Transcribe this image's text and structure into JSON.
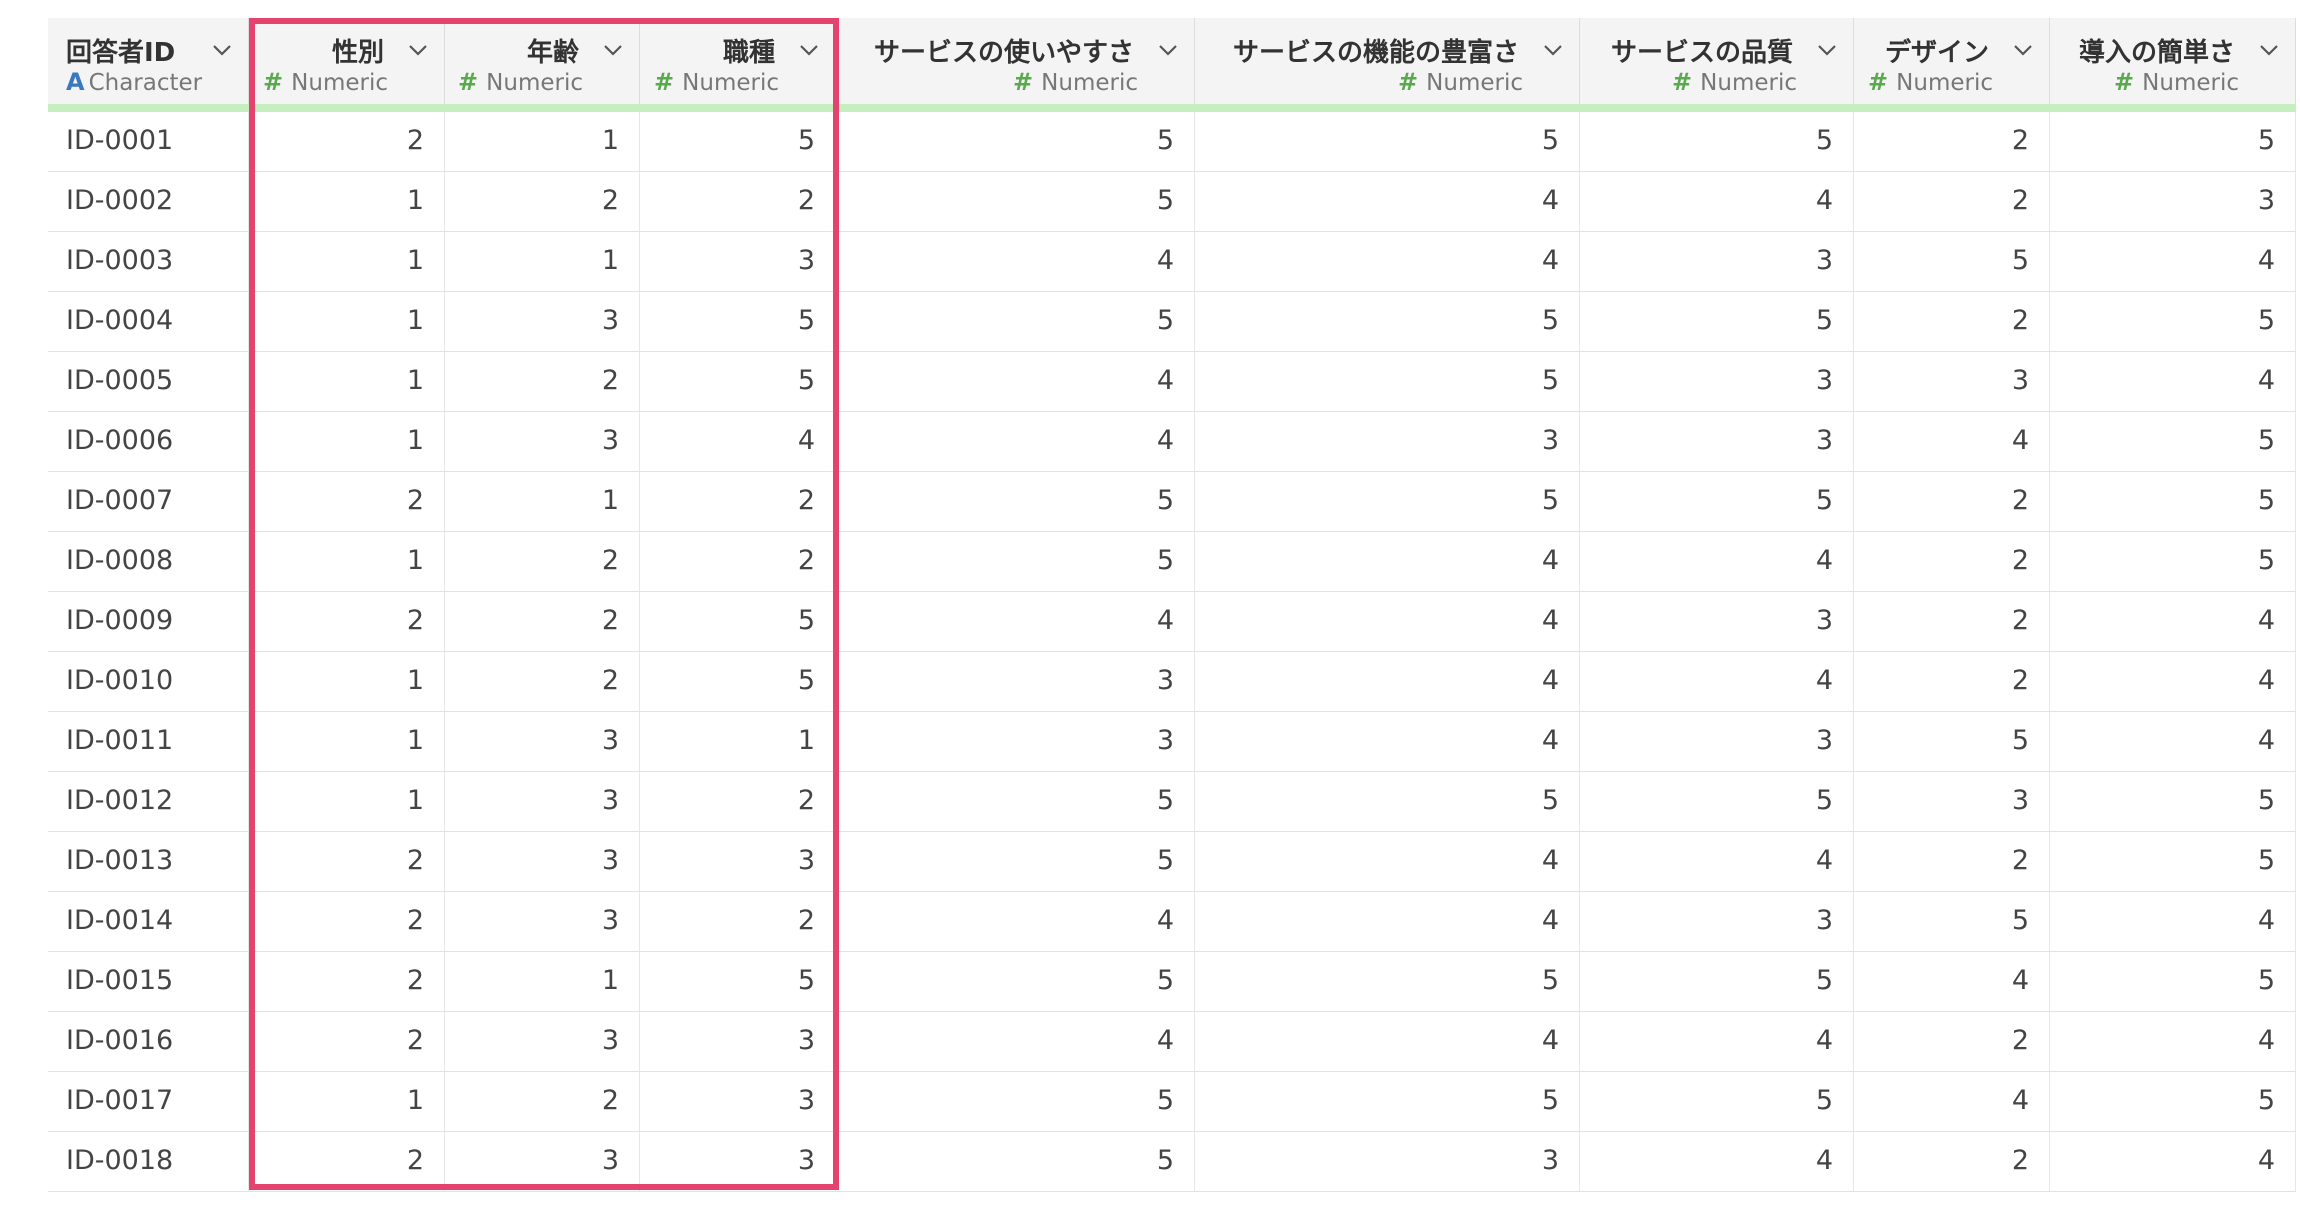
{
  "columns": [
    {
      "name": "回答者ID",
      "type": "Character",
      "type_icon": "character-type-icon"
    },
    {
      "name": "性別",
      "type": "Numeric",
      "type_icon": "numeric-type-icon"
    },
    {
      "name": "年齢",
      "type": "Numeric",
      "type_icon": "numeric-type-icon"
    },
    {
      "name": "職種",
      "type": "Numeric",
      "type_icon": "numeric-type-icon"
    },
    {
      "name": "サービスの使いやすさ",
      "type": "Numeric",
      "type_icon": "numeric-type-icon"
    },
    {
      "name": "サービスの機能の豊富さ",
      "type": "Numeric",
      "type_icon": "numeric-type-icon"
    },
    {
      "name": "サービスの品質",
      "type": "Numeric",
      "type_icon": "numeric-type-icon"
    },
    {
      "name": "デザイン",
      "type": "Numeric",
      "type_icon": "numeric-type-icon"
    },
    {
      "name": "導入の簡単さ",
      "type": "Numeric",
      "type_icon": "numeric-type-icon"
    }
  ],
  "rows": [
    [
      "ID-0001",
      "2",
      "1",
      "5",
      "5",
      "5",
      "5",
      "2",
      "5"
    ],
    [
      "ID-0002",
      "1",
      "2",
      "2",
      "5",
      "4",
      "4",
      "2",
      "3"
    ],
    [
      "ID-0003",
      "1",
      "1",
      "3",
      "4",
      "4",
      "3",
      "5",
      "4"
    ],
    [
      "ID-0004",
      "1",
      "3",
      "5",
      "5",
      "5",
      "5",
      "2",
      "5"
    ],
    [
      "ID-0005",
      "1",
      "2",
      "5",
      "4",
      "5",
      "3",
      "3",
      "4"
    ],
    [
      "ID-0006",
      "1",
      "3",
      "4",
      "4",
      "3",
      "3",
      "4",
      "5"
    ],
    [
      "ID-0007",
      "2",
      "1",
      "2",
      "5",
      "5",
      "5",
      "2",
      "5"
    ],
    [
      "ID-0008",
      "1",
      "2",
      "2",
      "5",
      "4",
      "4",
      "2",
      "5"
    ],
    [
      "ID-0009",
      "2",
      "2",
      "5",
      "4",
      "4",
      "3",
      "2",
      "4"
    ],
    [
      "ID-0010",
      "1",
      "2",
      "5",
      "3",
      "4",
      "4",
      "2",
      "4"
    ],
    [
      "ID-0011",
      "1",
      "3",
      "1",
      "3",
      "4",
      "3",
      "5",
      "4"
    ],
    [
      "ID-0012",
      "1",
      "3",
      "2",
      "5",
      "5",
      "5",
      "3",
      "5"
    ],
    [
      "ID-0013",
      "2",
      "3",
      "3",
      "5",
      "4",
      "4",
      "2",
      "5"
    ],
    [
      "ID-0014",
      "2",
      "3",
      "2",
      "4",
      "4",
      "3",
      "5",
      "4"
    ],
    [
      "ID-0015",
      "2",
      "1",
      "5",
      "5",
      "5",
      "5",
      "4",
      "5"
    ],
    [
      "ID-0016",
      "2",
      "3",
      "3",
      "4",
      "4",
      "4",
      "2",
      "4"
    ],
    [
      "ID-0017",
      "1",
      "2",
      "3",
      "5",
      "5",
      "5",
      "4",
      "5"
    ],
    [
      "ID-0018",
      "2",
      "3",
      "3",
      "5",
      "3",
      "4",
      "2",
      "4"
    ]
  ],
  "colors": {
    "highlight_border": "#e5436f",
    "header_underline": "#c6efc0",
    "numeric_icon": "#5aa94e",
    "character_icon": "#3a78c2"
  }
}
